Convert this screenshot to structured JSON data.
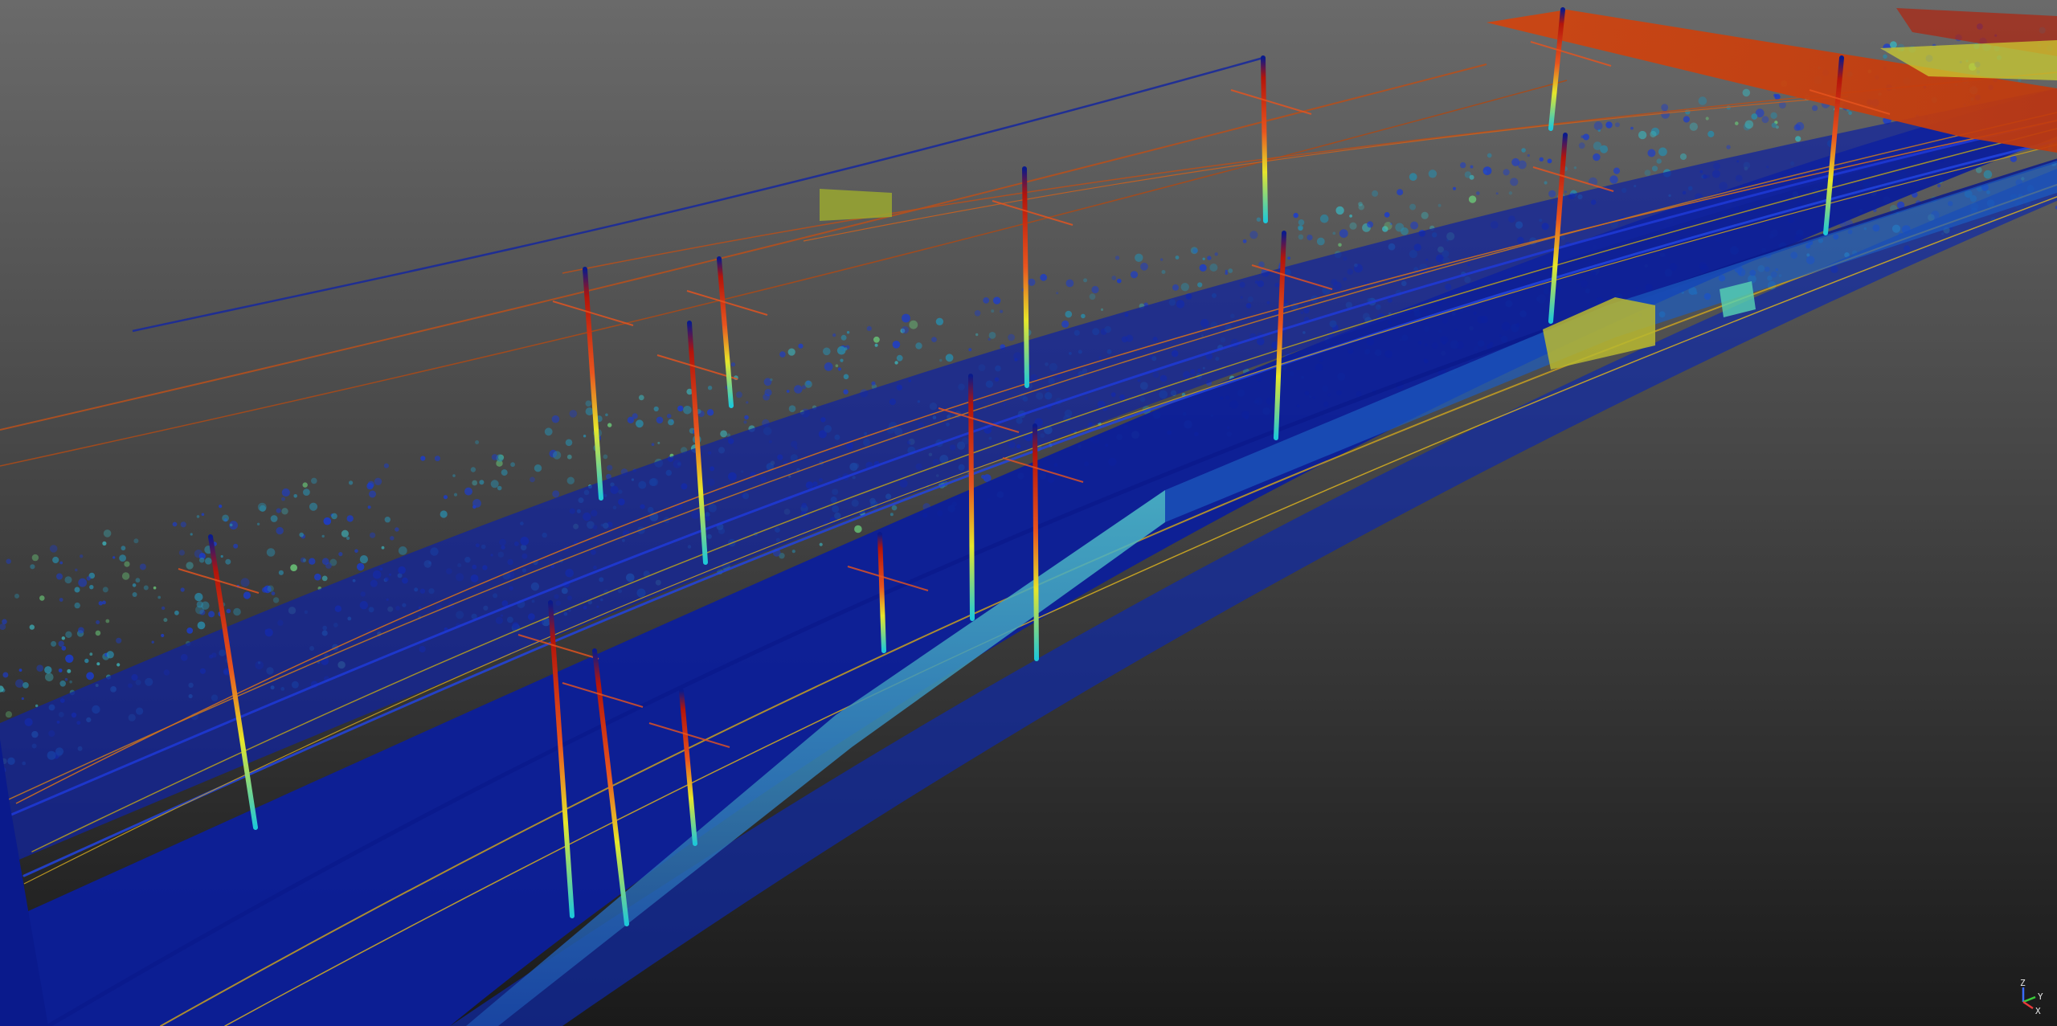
{
  "viewer": {
    "background_top": "#6a6a6a",
    "background_bottom": "#1a1a1a",
    "colormap": [
      "#0a1a8c",
      "#1a3cd0",
      "#1ec8d8",
      "#e6e62a",
      "#e8541e",
      "#b4140a"
    ]
  },
  "axis_gizmo": {
    "z_label": "Z",
    "y_label": "Y",
    "x_label": "X",
    "z_color": "#3a6cff",
    "y_color": "#3acd3a",
    "x_color": "#e83a3a"
  }
}
